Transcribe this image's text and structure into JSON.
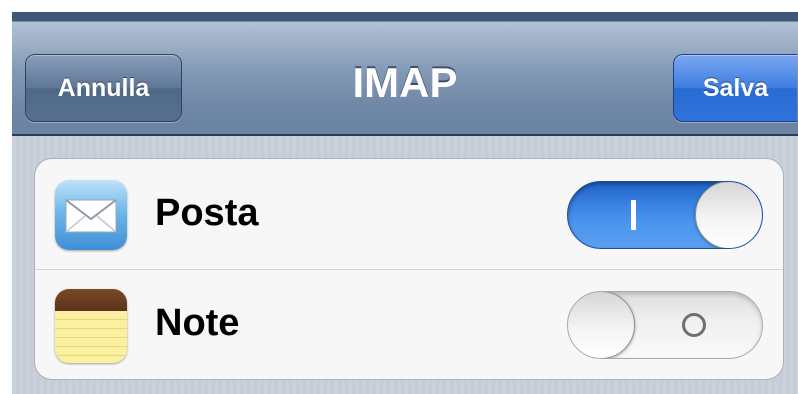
{
  "navbar": {
    "title": "IMAP",
    "cancel_label": "Annulla",
    "save_label": "Salva"
  },
  "settings": [
    {
      "label": "Posta",
      "icon": "mail-icon",
      "enabled": true
    },
    {
      "label": "Note",
      "icon": "notes-icon",
      "enabled": false
    }
  ],
  "colors": {
    "navbar": "#6f87a6",
    "save_button": "#2f72da",
    "switch_on": "#3d86e6",
    "switch_off": "#efefef"
  }
}
